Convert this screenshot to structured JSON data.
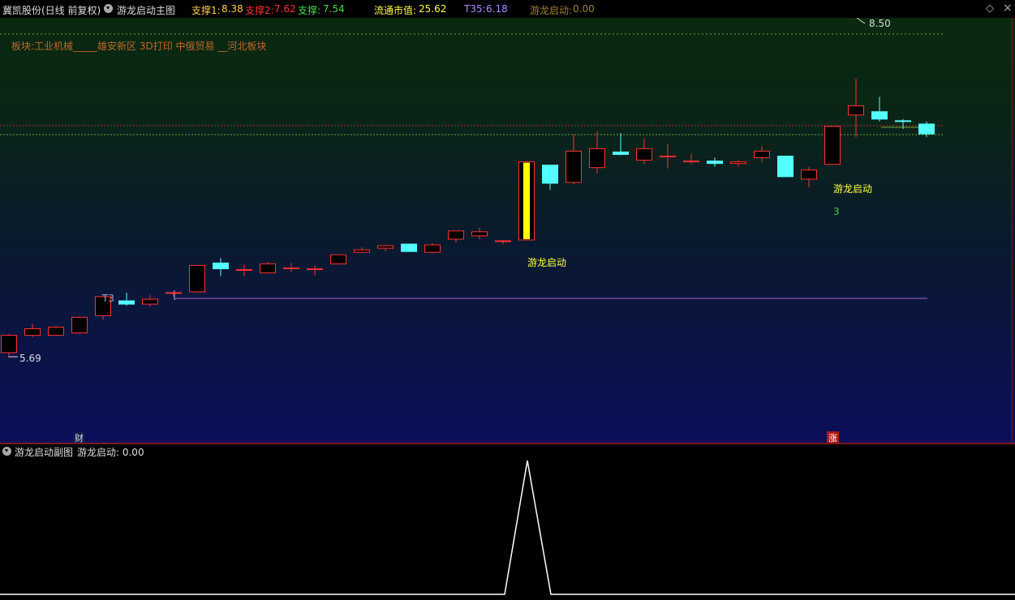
{
  "header": {
    "stock": "冀凯股份(日线 前复权)",
    "indicator": "游龙启动主图",
    "support1_label": "支撑1:",
    "support1_value": "8.38",
    "support2_label": "支撑2:",
    "support2_value": "7.62",
    "support_label": "支撑:",
    "support_value": "7.54",
    "mcap_label": "流通市值:",
    "mcap_value": "25.62",
    "t35_label": "T35:",
    "t35_value": "6.18",
    "start_label": "游龙启动:",
    "start_value": "0.00"
  },
  "sector_text": "板块:工业机械_____雄安新区 3D打印 中俄贸易 __河北板块",
  "labels": {
    "high": "8.50",
    "low": "5.69",
    "t3": "T3",
    "signal1": "游龙启动",
    "signal2": "游龙启动",
    "count": "3",
    "cai": "财",
    "zhang": "涨"
  },
  "sub": {
    "title": "游龙启动副图",
    "value_label": "游龙启动: 0.00"
  },
  "colors": {
    "up": "#ff3030",
    "down": "#54ffff",
    "signal_bar": "#ffff00",
    "support_line": "#6aa832",
    "resistance_line": "#b03030",
    "t35_line": "#b060d0",
    "header_support1": "#ffd040",
    "header_support2": "#ff3030",
    "header_support": "#40e040",
    "header_mcap": "#ffff40",
    "header_t35": "#b088ff",
    "header_start": "#a08030"
  },
  "candles": [
    {
      "o": 5.75,
      "h": 5.98,
      "l": 5.69,
      "c": 5.96
    },
    {
      "o": 5.96,
      "h": 6.1,
      "l": 5.94,
      "c": 6.04
    },
    {
      "o": 5.96,
      "h": 6.07,
      "l": 5.96,
      "c": 6.06
    },
    {
      "o": 5.99,
      "h": 6.19,
      "l": 5.98,
      "c": 6.18
    },
    {
      "o": 6.2,
      "h": 6.46,
      "l": 6.15,
      "c": 6.43
    },
    {
      "o": 6.38,
      "h": 6.48,
      "l": 6.32,
      "c": 6.34
    },
    {
      "o": 6.34,
      "h": 6.45,
      "l": 6.31,
      "c": 6.4
    },
    {
      "o": 6.48,
      "h": 6.49,
      "l": 6.43,
      "c": 6.48
    },
    {
      "o": 6.49,
      "h": 6.81,
      "l": 6.48,
      "c": 6.81
    },
    {
      "o": 6.84,
      "h": 6.9,
      "l": 6.68,
      "c": 6.77
    },
    {
      "o": 6.76,
      "h": 6.82,
      "l": 6.68,
      "c": 6.76
    },
    {
      "o": 6.72,
      "h": 6.85,
      "l": 6.72,
      "c": 6.83
    },
    {
      "o": 6.78,
      "h": 6.84,
      "l": 6.73,
      "c": 6.78
    },
    {
      "o": 6.76,
      "h": 6.81,
      "l": 6.69,
      "c": 6.77
    },
    {
      "o": 6.83,
      "h": 6.94,
      "l": 6.82,
      "c": 6.94
    },
    {
      "o": 6.97,
      "h": 7.03,
      "l": 6.97,
      "c": 7.0
    },
    {
      "o": 7.02,
      "h": 7.06,
      "l": 6.98,
      "c": 7.05
    },
    {
      "o": 7.07,
      "h": 7.07,
      "l": 6.98,
      "c": 6.98
    },
    {
      "o": 6.97,
      "h": 7.08,
      "l": 6.96,
      "c": 7.06
    },
    {
      "o": 7.13,
      "h": 7.23,
      "l": 7.09,
      "c": 7.23
    },
    {
      "o": 7.17,
      "h": 7.27,
      "l": 7.13,
      "c": 7.22
    },
    {
      "o": 7.1,
      "h": 7.12,
      "l": 7.07,
      "c": 7.11
    },
    {
      "o": 7.12,
      "h": 8.07,
      "l": 7.12,
      "c": 8.07
    },
    {
      "o": 8.03,
      "h": 8.03,
      "l": 7.73,
      "c": 7.81
    },
    {
      "o": 7.82,
      "h": 8.4,
      "l": 7.8,
      "c": 8.2
    },
    {
      "o": 8.0,
      "h": 8.44,
      "l": 7.93,
      "c": 8.23
    },
    {
      "o": 8.19,
      "h": 8.42,
      "l": 8.15,
      "c": 8.16
    },
    {
      "o": 8.09,
      "h": 8.35,
      "l": 8.04,
      "c": 8.23
    },
    {
      "o": 8.14,
      "h": 8.29,
      "l": 7.99,
      "c": 8.14
    },
    {
      "o": 8.08,
      "h": 8.17,
      "l": 8.04,
      "c": 8.08
    },
    {
      "o": 8.08,
      "h": 8.12,
      "l": 8.01,
      "c": 8.05
    },
    {
      "o": 8.05,
      "h": 8.09,
      "l": 8.01,
      "c": 8.07
    },
    {
      "o": 8.12,
      "h": 8.26,
      "l": 8.06,
      "c": 8.2
    },
    {
      "o": 8.14,
      "h": 8.14,
      "l": 7.89,
      "c": 7.89
    },
    {
      "o": 7.86,
      "h": 8.01,
      "l": 7.76,
      "c": 7.97
    },
    {
      "o": 8.04,
      "h": 8.5,
      "l": 8.04,
      "c": 8.5
    },
    {
      "o": 8.64,
      "h": 9.08,
      "l": 8.37,
      "c": 8.75
    },
    {
      "o": 8.68,
      "h": 8.86,
      "l": 8.56,
      "c": 8.59
    },
    {
      "o": 8.57,
      "h": 8.59,
      "l": 8.47,
      "c": 8.56
    },
    {
      "o": 8.53,
      "h": 8.56,
      "l": 8.37,
      "c": 8.41
    }
  ]
}
